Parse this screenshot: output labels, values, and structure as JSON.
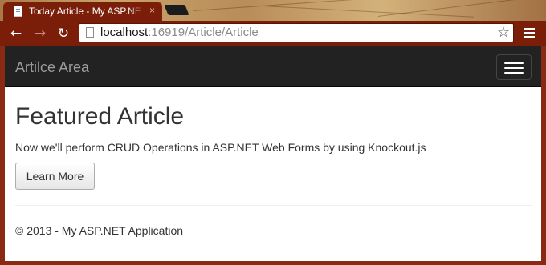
{
  "browser": {
    "tab_title": "Today Article - My ASP.NE",
    "tab_close": "×",
    "url_host": "localhost",
    "url_rest": ":16919/Article/Article",
    "back_icon": "←",
    "forward_icon": "→",
    "reload_icon": "↻",
    "star_icon": "☆"
  },
  "navbar": {
    "brand": "Artilce Area"
  },
  "main": {
    "heading": "Featured Article",
    "lead": "Now we'll perform CRUD Operations in ASP.NET Web Forms by using Knockout.js",
    "button_label": "Learn More"
  },
  "footer": {
    "text": "© 2013 - My ASP.NET Application"
  }
}
